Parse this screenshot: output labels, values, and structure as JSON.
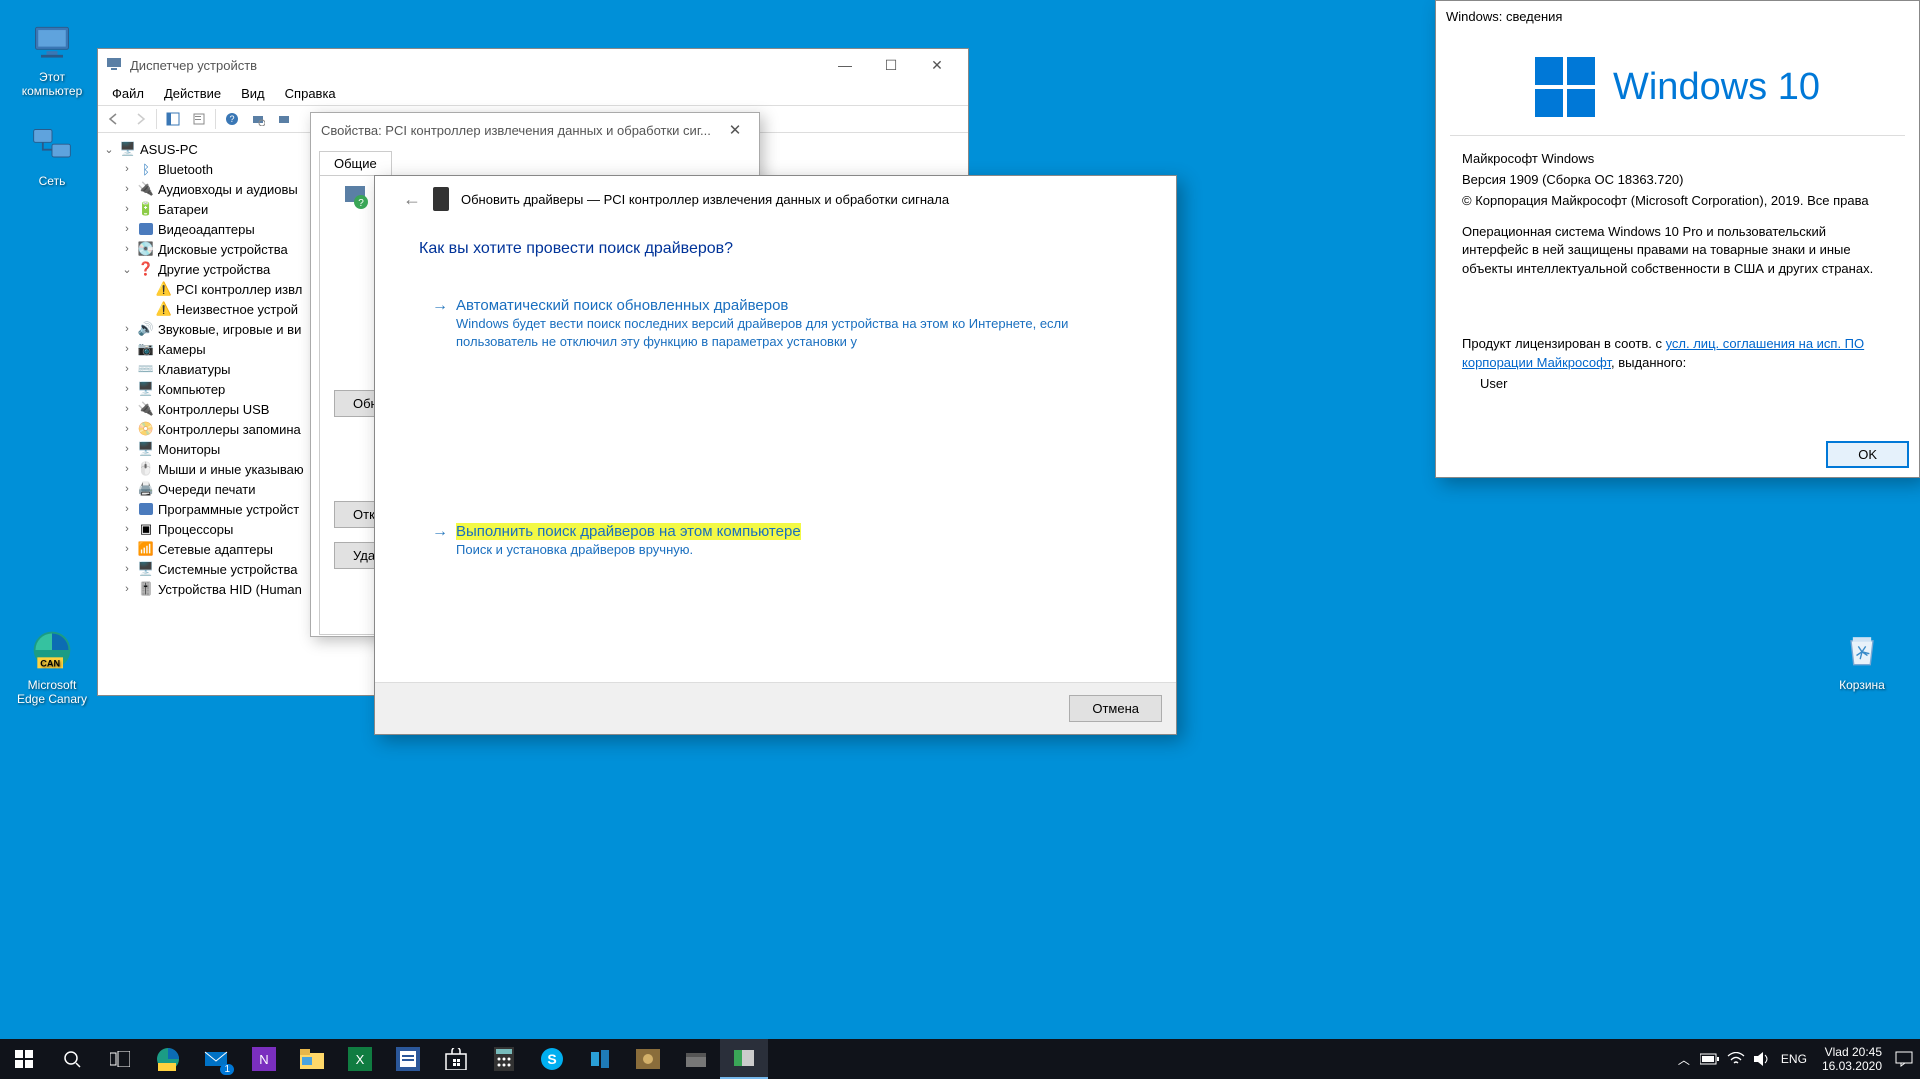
{
  "desktop": {
    "this_pc": "Этот компьютер",
    "network": "Сеть",
    "edge": "Microsoft Edge Canary",
    "recycle": "Корзина"
  },
  "devmgr": {
    "title": "Диспетчер устройств",
    "menu": {
      "file": "Файл",
      "action": "Действие",
      "view": "Вид",
      "help": "Справка"
    },
    "root": "ASUS-PC",
    "nodes": [
      "Bluetooth",
      "Аудиовходы и аудиовы",
      "Батареи",
      "Видеоадаптеры",
      "Дисковые устройства",
      "Другие устройства",
      "Звуковые, игровые и ви",
      "Камеры",
      "Клавиатуры",
      "Компьютер",
      "Контроллеры USB",
      "Контроллеры запомина",
      "Мониторы",
      "Мыши и иные указываю",
      "Очереди печати",
      "Программные устройст",
      "Процессоры",
      "Сетевые адаптеры",
      "Системные устройства",
      "Устройства HID (Human"
    ],
    "other": {
      "pci": "PCI контроллер извл",
      "unknown": "Неизвестное устрой"
    }
  },
  "propdlg": {
    "title": "Свойства: PCI контроллер извлечения данных и обработки сиг...",
    "tab_general": "Общие",
    "btn_update": "Обно",
    "btn_disable": "Отклю",
    "btn_uninstall": "Удали"
  },
  "wizard": {
    "breadcrumb": "Обновить драйверы — PCI контроллер извлечения данных и обработки сигнала",
    "heading": "Как вы хотите провести поиск драйверов?",
    "opt1_title": "Автоматический поиск обновленных драйверов",
    "opt1_desc": "Windows будет вести поиск последних версий драйверов для устройства на этом ко Интернете, если пользователь не отключил эту функцию в параметрах установки у",
    "opt2_title": "Выполнить поиск драйверов на этом компьютере",
    "opt2_desc": "Поиск и установка драйверов вручную.",
    "cancel": "Отмена"
  },
  "winver": {
    "title": "Windows: сведения",
    "brand": "Windows 10",
    "l1": "Майкрософт Windows",
    "l2": "Версия 1909 (Сборка ОС 18363.720)",
    "l3": "© Корпорация Майкрософт (Microsoft Corporation), 2019. Все права",
    "p1": "Операционная система Windows 10 Pro и пользовательский интерфейс в ней защищены правами на товарные знаки и иные объекты интеллектуальной собственности в США и других странах.",
    "lic_pre": "Продукт лицензирован в соотв. с ",
    "lic_link1": "усл. лиц. соглашения на исп. ПО корпорации Майкрософт",
    "lic_post": ", выданного:",
    "user": "User",
    "ok": "OK"
  },
  "taskbar": {
    "mail_badge": "1",
    "lang": "ENG",
    "user": "Vlad",
    "time": "20:45",
    "date": "16.03.2020"
  }
}
